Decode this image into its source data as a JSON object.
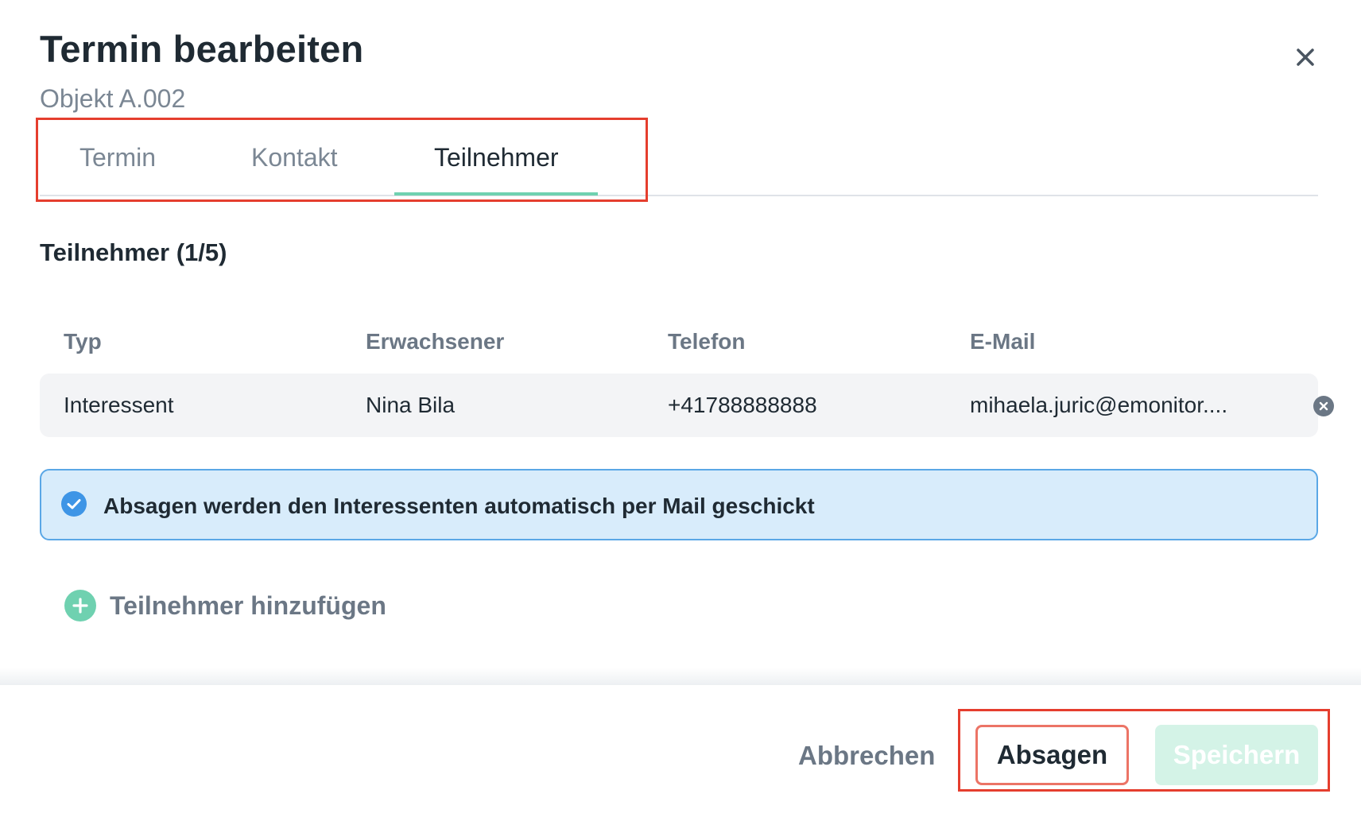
{
  "dialog": {
    "title": "Termin bearbeiten",
    "subtitle": "Objekt A.002"
  },
  "tabs": [
    {
      "label": "Termin",
      "active": false
    },
    {
      "label": "Kontakt",
      "active": false
    },
    {
      "label": "Teilnehmer",
      "active": true
    }
  ],
  "participants": {
    "section_title": "Teilnehmer (1/5)",
    "columns": [
      "Typ",
      "Erwachsener",
      "Telefon",
      "E-Mail"
    ],
    "rows": [
      {
        "typ": "Interessent",
        "name": "Nina Bila",
        "phone": "+41788888888",
        "email": "mihaela.juric@emonitor...."
      }
    ]
  },
  "info_banner": {
    "text": "Absagen werden den Interessenten automatisch per Mail geschickt"
  },
  "add_participant": {
    "label": "Teilnehmer hinzufügen"
  },
  "footer": {
    "cancel_label": "Abbrechen",
    "absagen_label": "Absagen",
    "save_label": "Speichern"
  },
  "colors": {
    "accent": "#6fd1b0",
    "annotation": "#e53e2e",
    "info_bg": "#d8ecfb",
    "info_border": "#5aa7e6",
    "save_disabled_bg": "#d4f3e7"
  },
  "icons": {
    "close": "close-icon",
    "remove_row": "remove-circle-icon",
    "info": "check-circle-icon",
    "add": "plus-circle-icon"
  }
}
